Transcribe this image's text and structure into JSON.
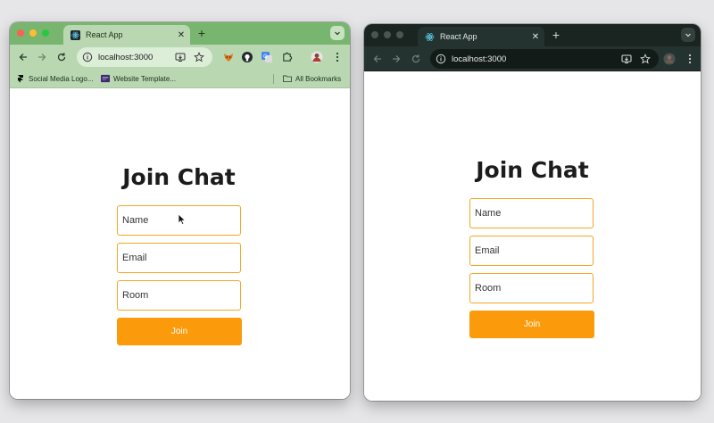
{
  "colors": {
    "accent_border": "#f5a623",
    "join_button": "#fb9a0a",
    "left_theme": "#78b56f",
    "right_theme": "#1a2421"
  },
  "left_window": {
    "tab_title": "React App",
    "url": "localhost:3000",
    "bookmarks": {
      "items": [
        "Social Media Logo...",
        "Website Template..."
      ],
      "all_bookmarks": "All Bookmarks"
    }
  },
  "right_window": {
    "tab_title": "React App",
    "url": "localhost:3000"
  },
  "form": {
    "heading": "Join Chat",
    "name_placeholder": "Name",
    "email_placeholder": "Email",
    "room_placeholder": "Room",
    "join_label": "Join"
  }
}
